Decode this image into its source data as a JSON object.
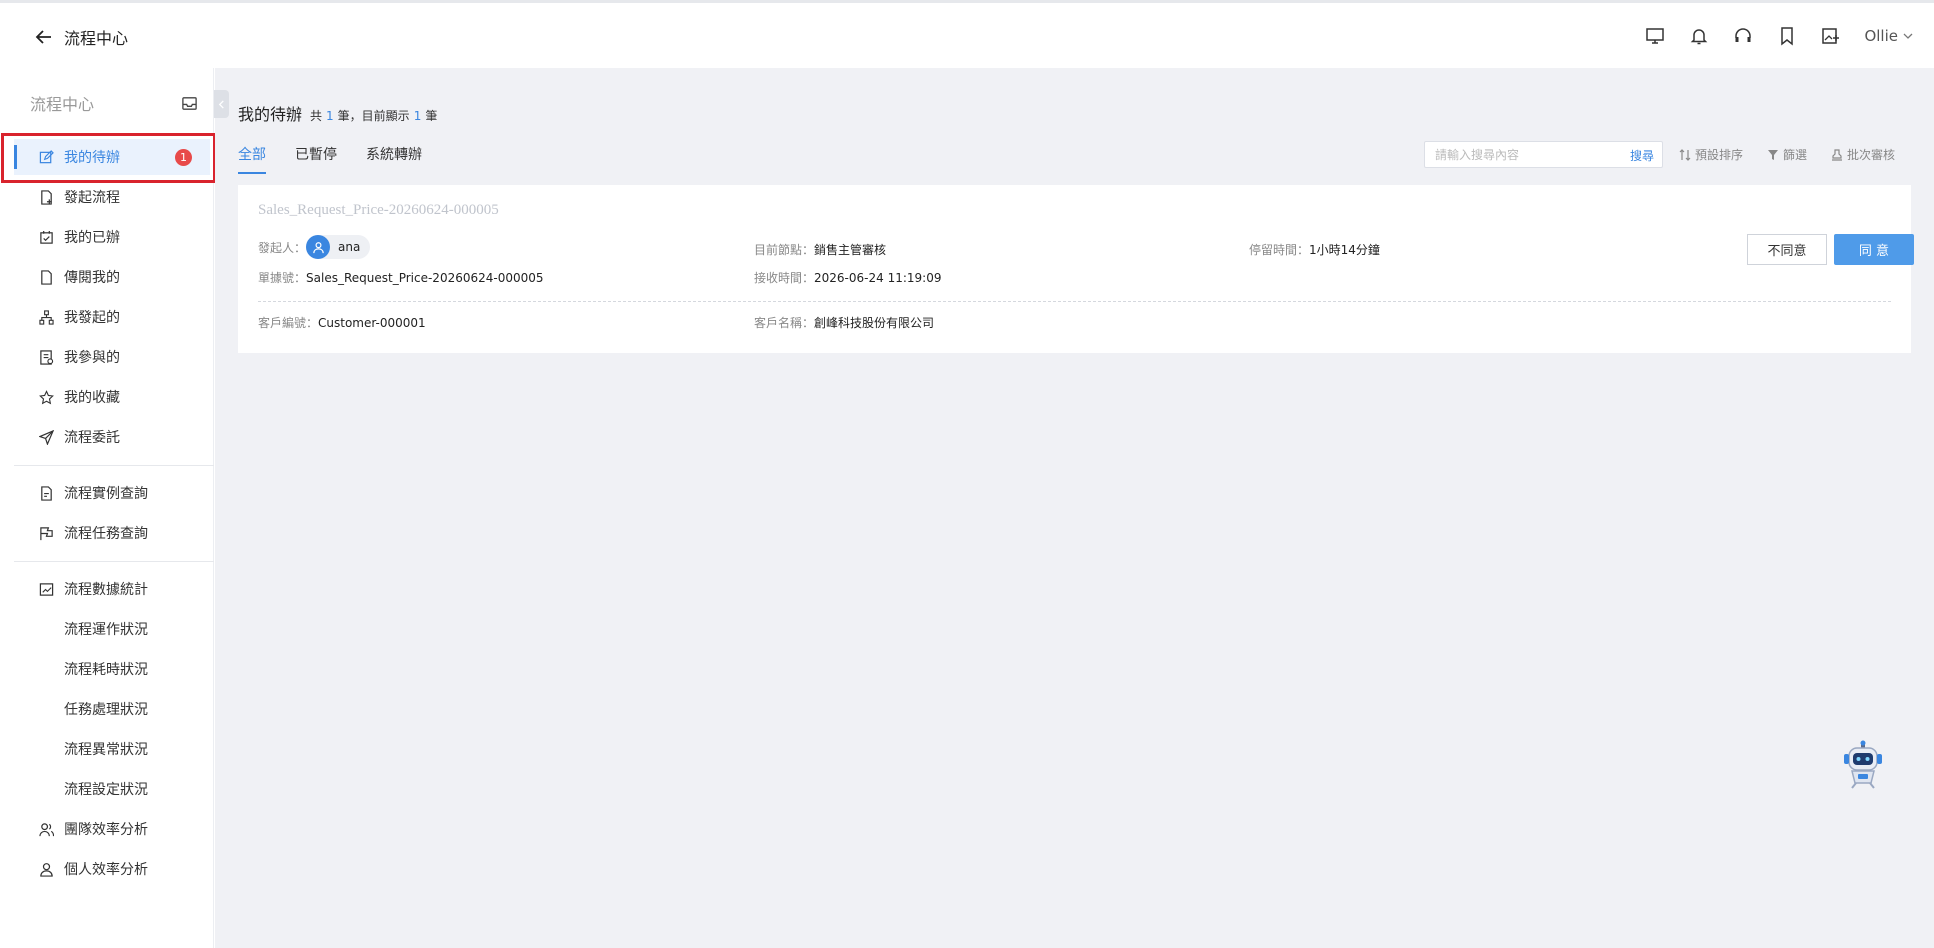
{
  "header": {
    "back_label": "流程中心",
    "user_name": "Ollie"
  },
  "sidebar": {
    "title": "流程中心",
    "items": [
      {
        "label": "我的待辦",
        "badge": "1",
        "icon": "edit-icon"
      },
      {
        "label": "發起流程",
        "icon": "file-add-icon"
      },
      {
        "label": "我的已辦",
        "icon": "calendar-check-icon"
      },
      {
        "label": "傳閱我的",
        "icon": "file-icon"
      },
      {
        "label": "我發起的",
        "icon": "hierarchy-icon"
      },
      {
        "label": "我參與的",
        "icon": "form-icon"
      },
      {
        "label": "我的收藏",
        "icon": "star-icon"
      },
      {
        "label": "流程委託",
        "icon": "send-icon"
      },
      {
        "label": "流程實例查詢",
        "icon": "file-search-icon"
      },
      {
        "label": "流程任務查詢",
        "icon": "flag-icon"
      },
      {
        "label": "流程數據統計",
        "icon": "chart-icon"
      },
      {
        "label": "流程運作狀況"
      },
      {
        "label": "流程耗時狀況"
      },
      {
        "label": "任務處理狀況"
      },
      {
        "label": "流程異常狀況"
      },
      {
        "label": "流程設定狀況"
      },
      {
        "label": "團隊效率分析",
        "icon": "team-icon"
      },
      {
        "label": "個人效率分析",
        "icon": "person-icon"
      }
    ]
  },
  "main": {
    "title": "我的待辦",
    "count_prefix": "共",
    "count_total": "1",
    "count_mid": "筆，目前顯示",
    "count_shown": "1",
    "count_suffix": "筆",
    "tabs": [
      "全部",
      "已暫停",
      "系統轉辦"
    ],
    "search_placeholder": "請輸入搜尋內容",
    "search_button": "搜尋",
    "tools": [
      "預設排序",
      "篩選",
      "批次審核"
    ]
  },
  "card": {
    "title": "Sales_Request_Price-20260624-000005",
    "initiator_label": "發起人：",
    "initiator_name": "ana",
    "current_node_label": "目前節點：",
    "current_node": "銷售主管審核",
    "stay_label": "停留時間：",
    "stay_value": "1小時14分鐘",
    "order_label": "單據號：",
    "order_value": "Sales_Request_Price-20260624-000005",
    "received_label": "接收時間：",
    "received_value": "2026-06-24 11:19:09",
    "customer_no_label": "客戶編號：",
    "customer_no": "Customer-000001",
    "customer_name_label": "客戶名稱：",
    "customer_name": "創峰科技股份有限公司",
    "reject_label": "不同意",
    "approve_label": "同 意"
  },
  "colors": {
    "accent": "#3a86e0",
    "badge": "#e84a4a",
    "highlight": "#d9232d"
  }
}
